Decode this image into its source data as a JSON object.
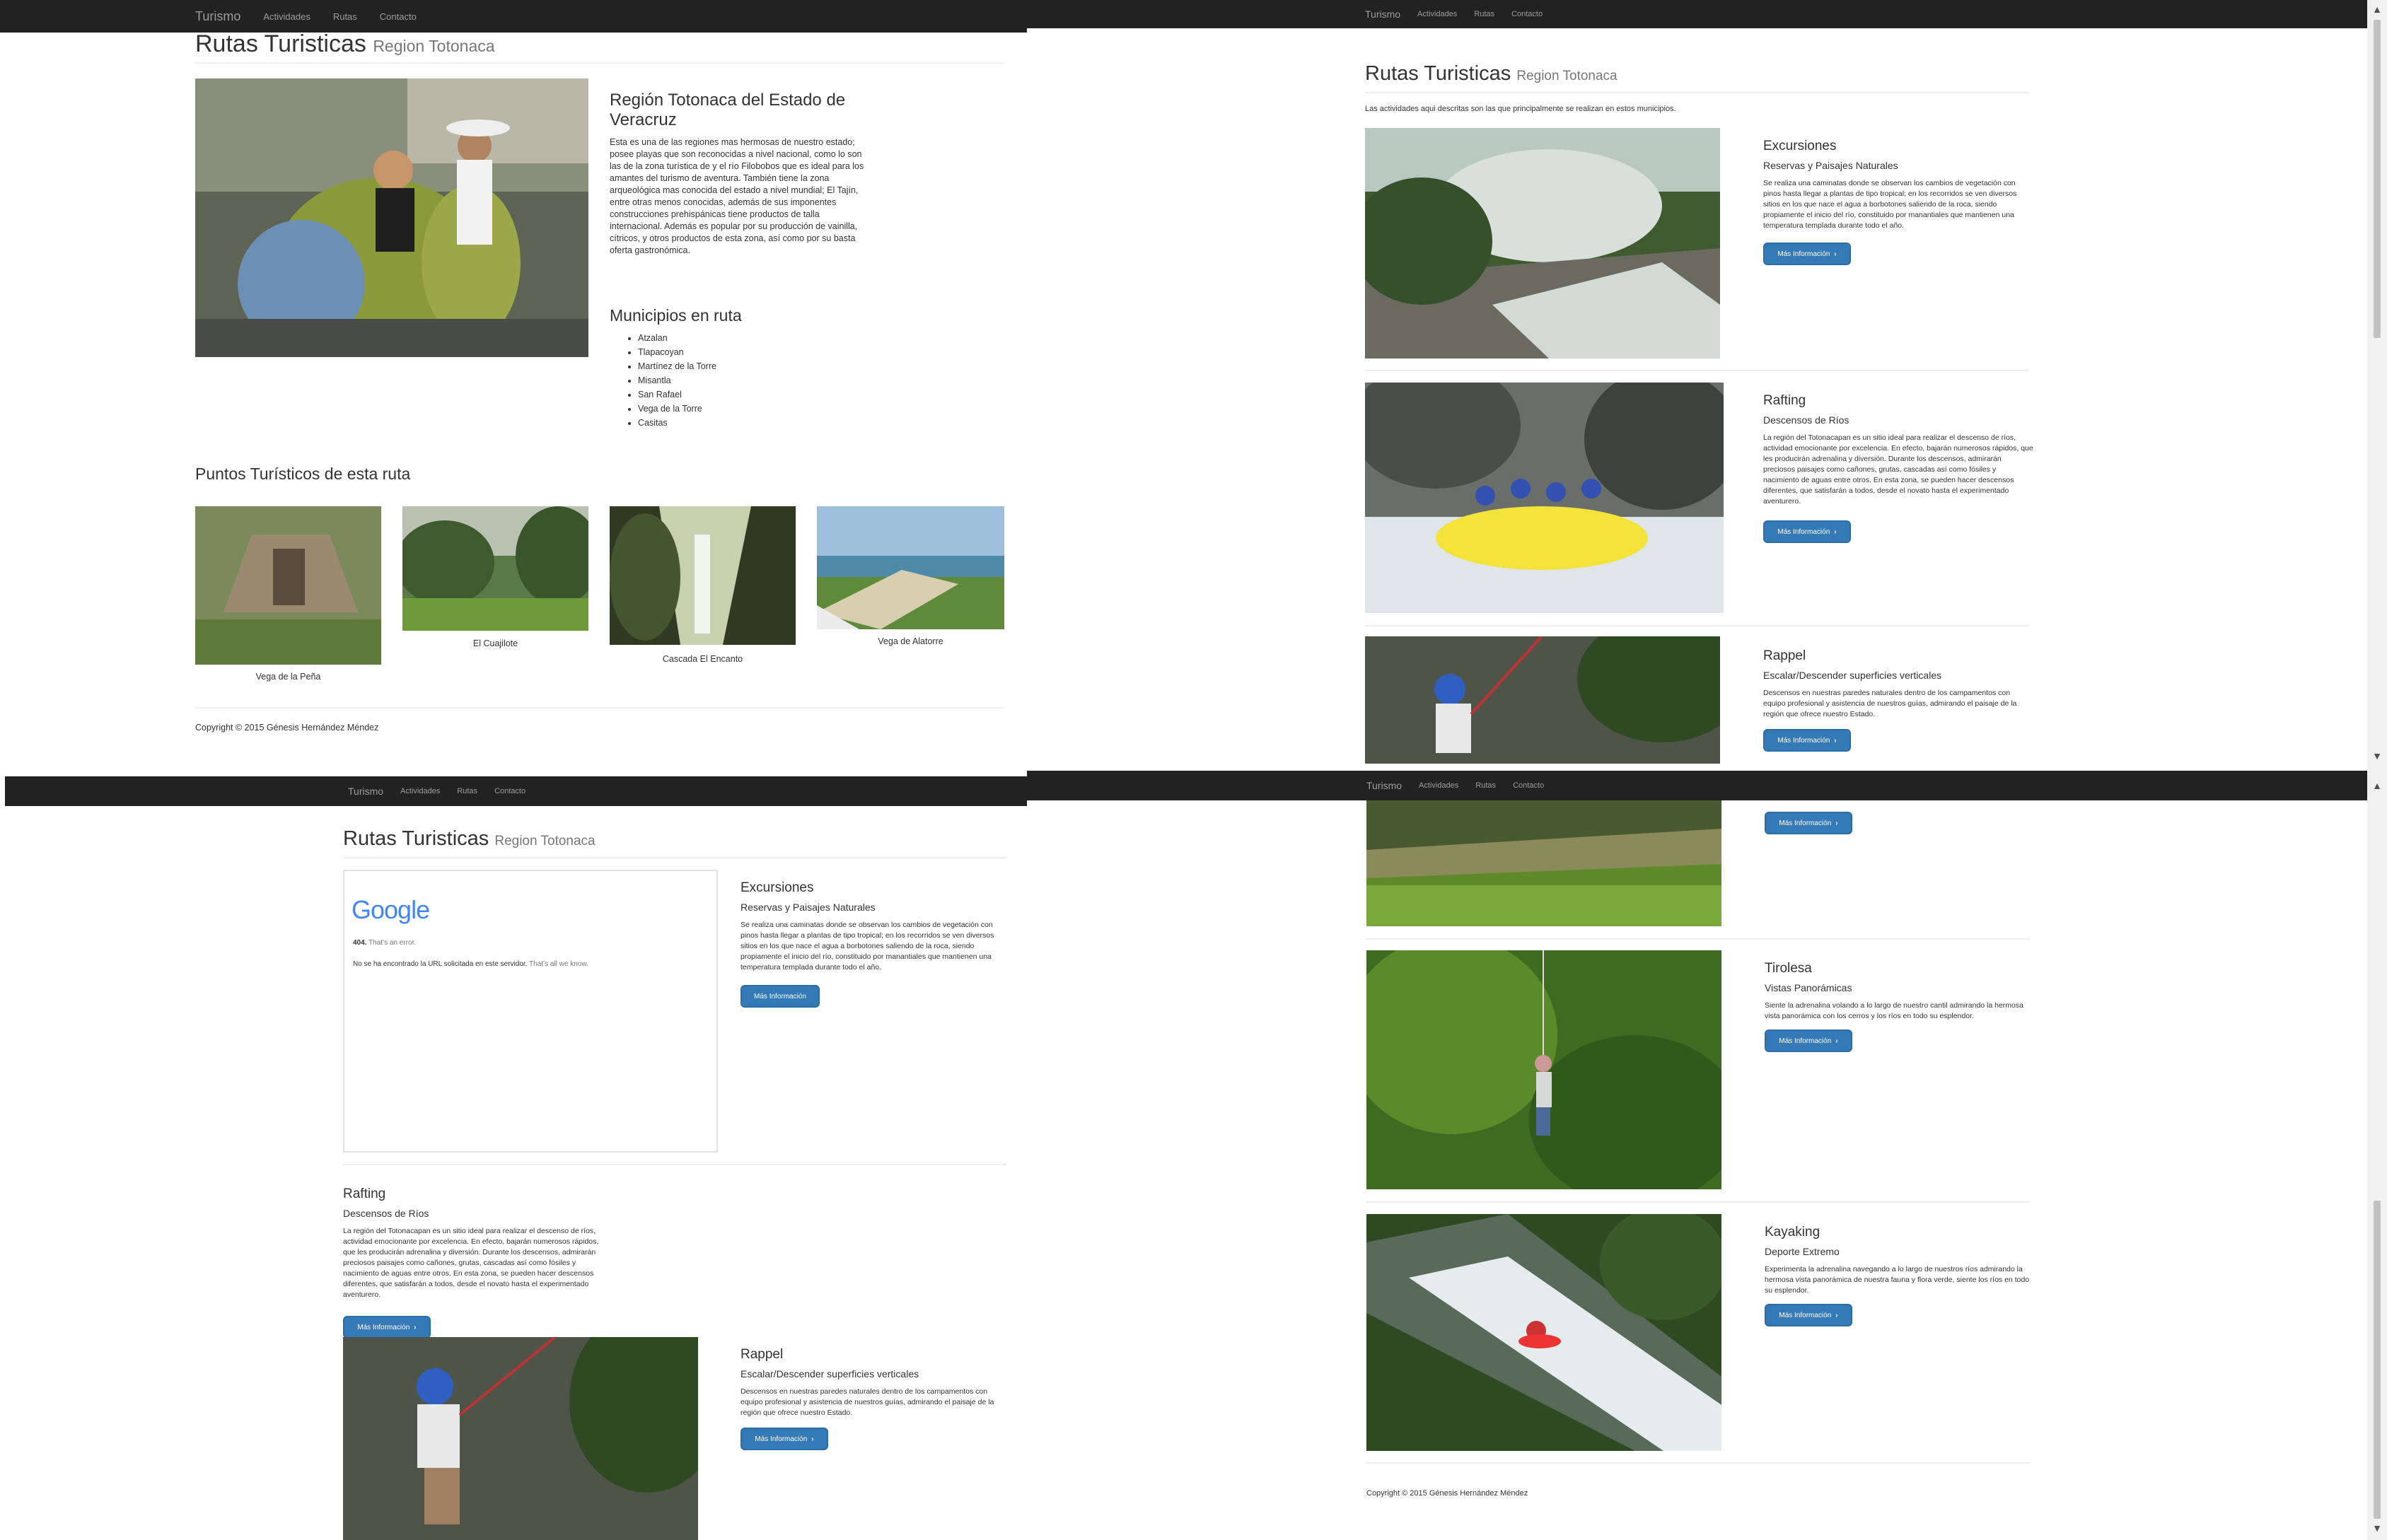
{
  "nav": {
    "brand": "Turismo",
    "items": [
      "Actividades",
      "Rutas",
      "Contacto"
    ]
  },
  "page": {
    "title": "Rutas Turisticas",
    "subtitle": "Region Totonaca",
    "intro": "Las actividades aqui descritas son las que principalmente se realizan en estos municipios.",
    "copyright": "Copyright © 2015 Génesis Hernández Méndez"
  },
  "region": {
    "heading": "Región Totonaca del Estado de Veracruz",
    "body": "Esta es una de las regiones mas hermosas de nuestro estado; posee playas que son reconocidas a nivel nacional, como lo son las de la zona turística de y el río Filobobos que es ideal para los amantes del turismo de aventura. También tiene la zona arqueológica mas conocida del estado a nivel mundial; El Tajín, entre otras menos conocidas, además de sus imponentes construcciones prehispánicas tiene productos de talla internacional. Además es popular por su producción de vainilla, cítricos, y otros productos de esta zona, así como por su basta oferta gastronómica.",
    "municipios_heading": "Municipios en ruta",
    "municipios": [
      "Atzalan",
      "Tlapacoyan",
      "Martínez de la Torre",
      "Misantla",
      "San Rafael",
      "Vega de la Torre",
      "Casitas"
    ]
  },
  "puntos": {
    "heading": "Puntos Turísticos de esta ruta",
    "items": [
      {
        "caption": "Vega de la Peña"
      },
      {
        "caption": "El Cuajilote"
      },
      {
        "caption": "Cascada El Encanto"
      },
      {
        "caption": "Vega de Alatorre"
      }
    ]
  },
  "activities": [
    {
      "title": "Excursiones",
      "subtitle": "Reservas y Paisajes Naturales",
      "text": "Se realiza una caminatas donde se observan los cambios de vegetación con pinos hasta llegar a plantas de tipo tropical; en los recorridos se ven diversos sitios en los que nace el agua a borbotones saliendo de la roca, siendo propiamente el inicio del río, constituido por manantiales que mantienen una temperatura templada durante todo el año."
    },
    {
      "title": "Rafting",
      "subtitle": "Descensos de Ríos",
      "text": "La región del Totonacapan es un sitio ideal para realizar el descenso de ríos, actividad emocionante por excelencia. En efecto, bajarán numerosos rápidos, que les producirán adrenalina y diversión. Durante los descensos, admirarán preciosos paisajes como cañones, grutas, cascadas así como fósiles y nacimiento de aguas entre otros. En esta zona, se pueden hacer descensos diferentes, que satisfarán a todos, desde el novato hasta el experimentado aventurero."
    },
    {
      "title": "Rappel",
      "subtitle": "Escalar/Descender superficies verticales",
      "text": "Descensos en nuestras paredes naturales dentro de los campamentos con equipo profesional y asistencia de nuestros guías, admirando el paisaje de la región que ofrece nuestro Estado."
    },
    {
      "title": "Tirolesa",
      "subtitle": "Vistas Panorámicas",
      "text": "Siente la adrenalina volando a lo largo de nuestro cantil admirando la hermosa vista panorámica con los cerros y los ríos en todo su esplendor."
    },
    {
      "title": "Kayaking",
      "subtitle": "Deporte Extremo",
      "text": "Experimenta la adrenalina navegando a lo largo de nuestros ríos admirando la hermosa vista panorámica de nuestra fauna y flora verde, siente los ríos en todo su esplendor."
    }
  ],
  "button_label": "Más Información",
  "google_error": {
    "logo": "Google",
    "code": "404.",
    "code_note": "That’s an error.",
    "message": "No se ha encontrado la URL solicitada en este servidor.",
    "message_note": "That’s all we know."
  },
  "colors": {
    "navbar": "#222222",
    "button": "#337ab7",
    "nav_text": "#9d9d9d"
  }
}
